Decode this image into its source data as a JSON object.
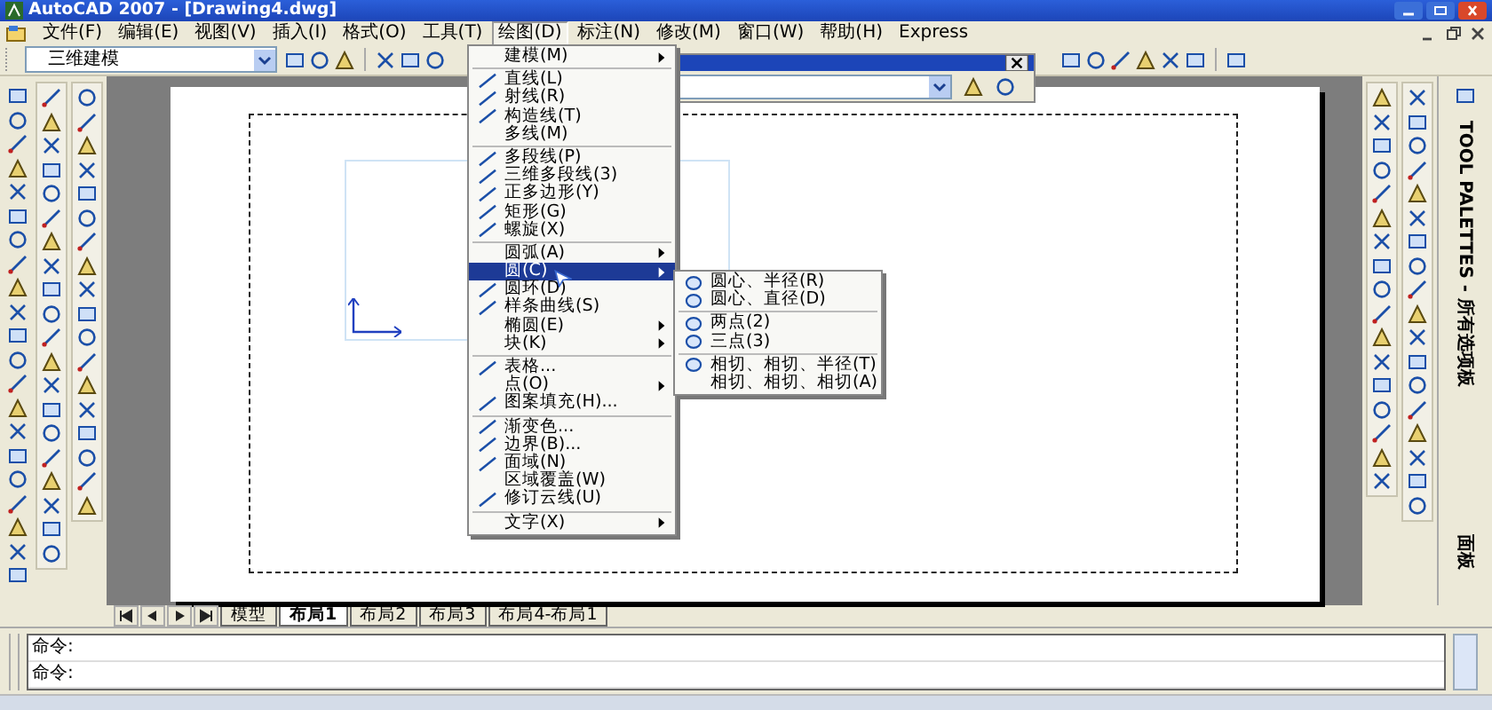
{
  "window": {
    "title": "AutoCAD 2007 - [Drawing4.dwg]"
  },
  "menu_bar": [
    {
      "label": "文件(F)",
      "selected": false
    },
    {
      "label": "编辑(E)",
      "selected": false
    },
    {
      "label": "视图(V)",
      "selected": false
    },
    {
      "label": "插入(I)",
      "selected": false
    },
    {
      "label": "格式(O)",
      "selected": false
    },
    {
      "label": "工具(T)",
      "selected": false
    },
    {
      "label": "绘图(D)",
      "selected": true
    },
    {
      "label": "标注(N)",
      "selected": false
    },
    {
      "label": "修改(M)",
      "selected": false
    },
    {
      "label": "窗口(W)",
      "selected": false
    },
    {
      "label": "帮助(H)",
      "selected": false
    },
    {
      "label": "Express",
      "selected": false
    }
  ],
  "toolbar": {
    "workspace": "三维建模"
  },
  "draw_menu": [
    {
      "kind": "item",
      "label": "建模(M)",
      "icon": false,
      "submenu": true,
      "selected": false
    },
    {
      "kind": "separator"
    },
    {
      "kind": "item",
      "label": "直线(L)",
      "icon": true,
      "submenu": false,
      "selected": false
    },
    {
      "kind": "item",
      "label": "射线(R)",
      "icon": true,
      "submenu": false,
      "selected": false
    },
    {
      "kind": "item",
      "label": "构造线(T)",
      "icon": true,
      "submenu": false,
      "selected": false
    },
    {
      "kind": "item",
      "label": "多线(M)",
      "icon": false,
      "submenu": false,
      "selected": false
    },
    {
      "kind": "separator"
    },
    {
      "kind": "item",
      "label": "多段线(P)",
      "icon": true,
      "submenu": false,
      "selected": false
    },
    {
      "kind": "item",
      "label": "三维多段线(3)",
      "icon": true,
      "submenu": false,
      "selected": false
    },
    {
      "kind": "item",
      "label": "正多边形(Y)",
      "icon": true,
      "submenu": false,
      "selected": false
    },
    {
      "kind": "item",
      "label": "矩形(G)",
      "icon": true,
      "submenu": false,
      "selected": false
    },
    {
      "kind": "item",
      "label": "螺旋(X)",
      "icon": true,
      "submenu": false,
      "selected": false
    },
    {
      "kind": "separator"
    },
    {
      "kind": "item",
      "label": "圆弧(A)",
      "icon": false,
      "submenu": true,
      "selected": false
    },
    {
      "kind": "item",
      "label": "圆(C)",
      "icon": false,
      "submenu": true,
      "selected": true
    },
    {
      "kind": "item",
      "label": "圆环(D)",
      "icon": true,
      "submenu": false,
      "selected": false
    },
    {
      "kind": "item",
      "label": "样条曲线(S)",
      "icon": true,
      "submenu": false,
      "selected": false
    },
    {
      "kind": "item",
      "label": "椭圆(E)",
      "icon": false,
      "submenu": true,
      "selected": false
    },
    {
      "kind": "item",
      "label": "块(K)",
      "icon": false,
      "submenu": true,
      "selected": false
    },
    {
      "kind": "separator"
    },
    {
      "kind": "item",
      "label": "表格...",
      "icon": true,
      "submenu": false,
      "selected": false
    },
    {
      "kind": "item",
      "label": "点(O)",
      "icon": false,
      "submenu": true,
      "selected": false
    },
    {
      "kind": "item",
      "label": "图案填充(H)...",
      "icon": true,
      "submenu": false,
      "selected": false
    },
    {
      "kind": "separator"
    },
    {
      "kind": "item",
      "label": "渐变色...",
      "icon": true,
      "submenu": false,
      "selected": false
    },
    {
      "kind": "item",
      "label": "边界(B)...",
      "icon": true,
      "submenu": false,
      "selected": false
    },
    {
      "kind": "item",
      "label": "面域(N)",
      "icon": true,
      "submenu": false,
      "selected": false
    },
    {
      "kind": "item",
      "label": "区域覆盖(W)",
      "icon": false,
      "submenu": false,
      "selected": false
    },
    {
      "kind": "item",
      "label": "修订云线(U)",
      "icon": true,
      "submenu": false,
      "selected": false
    },
    {
      "kind": "separator"
    },
    {
      "kind": "item",
      "label": "文字(X)",
      "icon": false,
      "submenu": true,
      "selected": false
    }
  ],
  "circle_submenu": [
    {
      "kind": "item",
      "label": "圆心、半径(R)",
      "icon": true
    },
    {
      "kind": "item",
      "label": "圆心、直径(D)",
      "icon": true
    },
    {
      "kind": "separator"
    },
    {
      "kind": "item",
      "label": "两点(2)",
      "icon": true
    },
    {
      "kind": "item",
      "label": "三点(3)",
      "icon": true
    },
    {
      "kind": "separator"
    },
    {
      "kind": "item",
      "label": "相切、相切、半径(T)",
      "icon": true
    },
    {
      "kind": "item",
      "label": "相切、相切、相切(A)",
      "icon": false
    }
  ],
  "layout_tabs": [
    {
      "label": "模型",
      "selected": false
    },
    {
      "label": "布局1",
      "selected": true
    },
    {
      "label": "布局2",
      "selected": false
    },
    {
      "label": "布局3",
      "selected": false
    },
    {
      "label": "布局4-布局1",
      "selected": false
    }
  ],
  "command_lines": [
    "命令:",
    "命令:"
  ],
  "tool_palettes": {
    "title": "TOOL PALETTES - 所有选项板",
    "tab": "面板"
  }
}
